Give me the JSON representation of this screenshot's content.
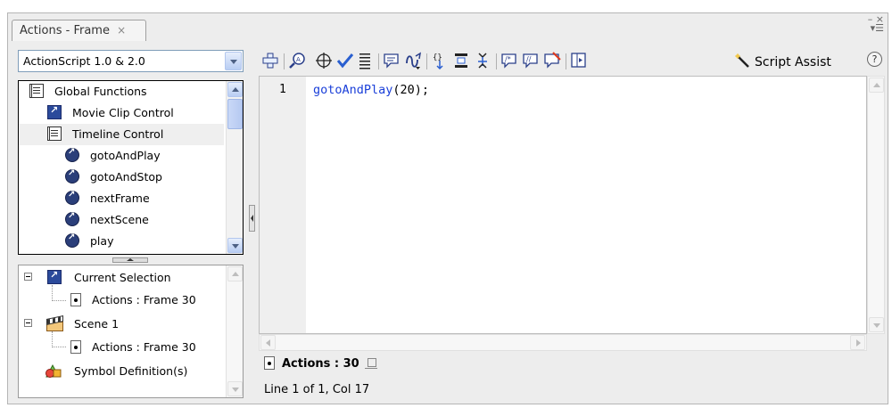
{
  "window": {
    "tab_label": "Actions - Frame",
    "tab_close": "×",
    "panel_controls": "– ×\n▾☰"
  },
  "toolbox": {
    "version_select": "ActionScript 1.0 & 2.0",
    "items": [
      {
        "label": "Global Functions",
        "icon": "book-icon"
      },
      {
        "label": "Movie Clip Control",
        "icon": "movieclip-category-icon"
      },
      {
        "label": "Timeline Control",
        "icon": "book-icon"
      },
      {
        "label": "gotoAndPlay",
        "icon": "function-icon"
      },
      {
        "label": "gotoAndStop",
        "icon": "function-icon"
      },
      {
        "label": "nextFrame",
        "icon": "function-icon"
      },
      {
        "label": "nextScene",
        "icon": "function-icon"
      },
      {
        "label": "play",
        "icon": "function-icon"
      }
    ]
  },
  "script_navigator": {
    "items": [
      {
        "label": "Current Selection"
      },
      {
        "label": "Actions : Frame 30"
      },
      {
        "label": "Scene 1"
      },
      {
        "label": "Actions : Frame 30"
      },
      {
        "label": "Symbol Definition(s)"
      }
    ]
  },
  "toolbar": {
    "buttons": [
      "add-item-icon",
      "find-icon",
      "insert-target-path-icon",
      "check-syntax-icon",
      "auto-format-icon",
      "show-code-hint-icon",
      "debug-options-icon",
      "collapse-between-braces-icon",
      "collapse-selection-icon",
      "expand-all-icon",
      "apply-block-comment-icon",
      "apply-line-comment-icon",
      "remove-comment-icon",
      "show-hide-toolbox-icon"
    ],
    "script_assist": "Script Assist",
    "help": "?"
  },
  "editor": {
    "line_number": "1",
    "code_keyword": "gotoAndPlay",
    "code_rest": "(20);"
  },
  "script_tab": {
    "label": "Actions : 30"
  },
  "status": {
    "position": "Line 1 of 1, Col 17"
  },
  "colors": {
    "code_keyword": "#1a3fd9",
    "panel_bg": "#ededed",
    "selection_bg": "#efefef"
  }
}
